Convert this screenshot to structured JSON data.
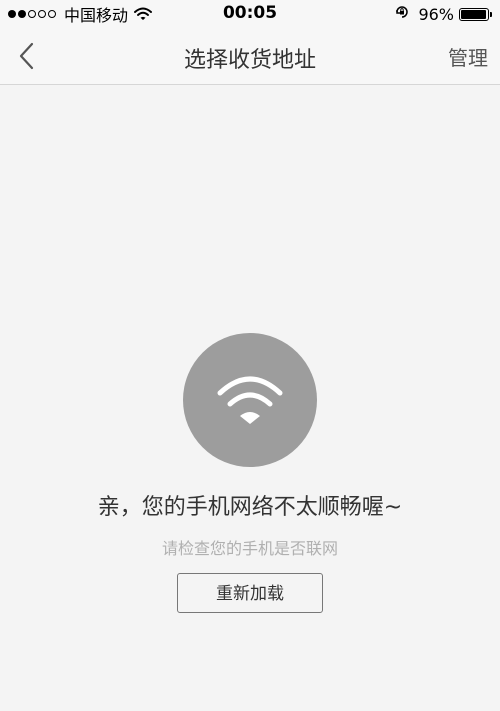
{
  "status_bar": {
    "signal": {
      "filled": 2,
      "total": 5
    },
    "carrier": "中国移动",
    "time": "00:05",
    "battery_percent_text": "96%",
    "battery_level": 0.96
  },
  "nav": {
    "title": "选择收货地址",
    "manage_label": "管理"
  },
  "empty_state": {
    "message": "亲，您的手机网络不太顺畅喔~",
    "hint": "请检查您的手机是否联网",
    "reload_label": "重新加载"
  },
  "icons": {
    "back": "chevron-left-icon",
    "wifi": "wifi-icon",
    "lock": "rotation-lock-icon"
  },
  "colors": {
    "background": "#f4f4f4",
    "icon_circle": "#9d9d9d"
  }
}
